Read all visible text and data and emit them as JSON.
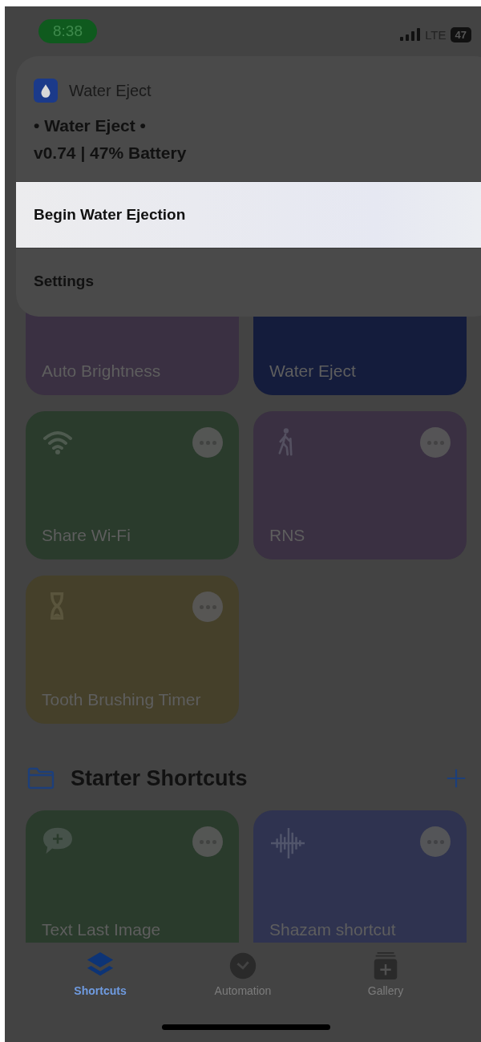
{
  "status_bar": {
    "time": "8:38",
    "network": "LTE",
    "battery": "47"
  },
  "menu": {
    "app_name": "Water Eject",
    "message_lines": [
      "• Water Eject •",
      "v0.74 | 47% Battery"
    ],
    "items": [
      {
        "label": "Begin Water Ejection",
        "selected": true
      },
      {
        "label": "Settings",
        "selected": false
      }
    ]
  },
  "shortcuts": [
    {
      "name": "Auto Brightness",
      "color": "#3a3042",
      "kind": "covered"
    },
    {
      "name": "Water Eject",
      "color": "#141c3c",
      "kind": "covered"
    },
    {
      "name": "Share Wi-Fi",
      "color": "#2a3b2c",
      "kind": "wifi"
    },
    {
      "name": "RNS",
      "color": "#3a3042",
      "kind": "walker"
    },
    {
      "name": "Tooth Brushing Timer",
      "color": "#45402a",
      "kind": "hourglass"
    }
  ],
  "section": {
    "title": "Starter Shortcuts"
  },
  "starter_shortcuts": [
    {
      "name": "Text Last Image",
      "color": "#2a3b2c",
      "kind": "message"
    },
    {
      "name": "Shazam shortcut",
      "color": "#2f3350",
      "kind": "waveform"
    }
  ],
  "tabs": [
    {
      "label": "Shortcuts",
      "kind": "layers",
      "selected": true
    },
    {
      "label": "Automation",
      "kind": "clock",
      "selected": false
    },
    {
      "label": "Gallery",
      "kind": "gallery",
      "selected": false
    }
  ]
}
